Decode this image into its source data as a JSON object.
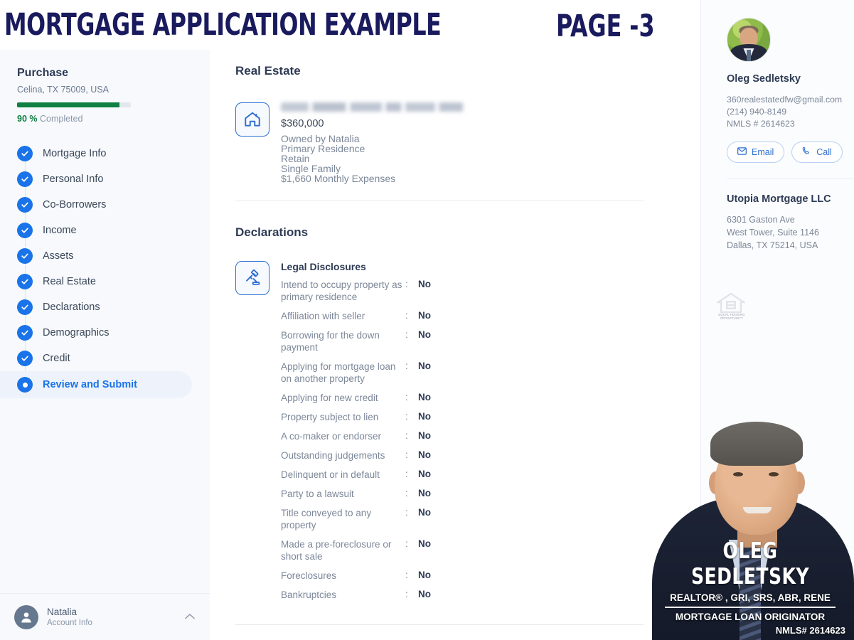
{
  "banner": {
    "title": "MORTGAGE APPLICATION EXAMPLE",
    "page_label": "PAGE -3",
    "color": "#1a1a5e"
  },
  "sidebar": {
    "purchase_label": "Purchase",
    "property_address": "Celina, TX 75009, USA",
    "progress_percent": "90 %",
    "progress_value": 90,
    "progress_suffix": "Completed",
    "progress_color": "#108043",
    "steps": [
      {
        "label": "Mortgage Info",
        "state": "complete"
      },
      {
        "label": "Personal Info",
        "state": "complete"
      },
      {
        "label": "Co-Borrowers",
        "state": "complete"
      },
      {
        "label": "Income",
        "state": "complete"
      },
      {
        "label": "Assets",
        "state": "complete"
      },
      {
        "label": "Real Estate",
        "state": "complete"
      },
      {
        "label": "Declarations",
        "state": "complete"
      },
      {
        "label": "Demographics",
        "state": "complete"
      },
      {
        "label": "Credit",
        "state": "complete"
      },
      {
        "label": "Review and Submit",
        "state": "active"
      }
    ],
    "footer": {
      "user_name": "Natalia",
      "user_sub": "Account Info",
      "chevron": "chevron-up-icon"
    }
  },
  "main": {
    "real_estate": {
      "heading": "Real Estate",
      "icon": "house-icon",
      "address_redacted": "",
      "value": "$360,000",
      "owned_by": "Owned by Natalia",
      "occupancy": "Primary Residence",
      "disposition": "Retain",
      "property_type": "Single Family",
      "expenses": "$1,660 Monthly Expenses"
    },
    "declarations": {
      "heading": "Declarations",
      "icon": "gavel-icon",
      "group_title": "Legal Disclosures",
      "separator": ":",
      "items": [
        {
          "question": "Intend to occupy property as primary residence",
          "answer": "No"
        },
        {
          "question": "Affiliation with seller",
          "answer": "No"
        },
        {
          "question": "Borrowing for the down payment",
          "answer": "No"
        },
        {
          "question": "Applying for mortgage loan on another property",
          "answer": "No"
        },
        {
          "question": "Applying for new credit",
          "answer": "No"
        },
        {
          "question": "Property subject to lien",
          "answer": "No"
        },
        {
          "question": "A co-maker or endorser",
          "answer": "No"
        },
        {
          "question": "Outstanding judgements",
          "answer": "No"
        },
        {
          "question": "Delinquent or in default",
          "answer": "No"
        },
        {
          "question": "Party to a lawsuit",
          "answer": "No"
        },
        {
          "question": "Title conveyed to any property",
          "answer": "No"
        },
        {
          "question": "Made a pre-foreclosure or short sale",
          "answer": "No"
        },
        {
          "question": "Foreclosures",
          "answer": "No"
        },
        {
          "question": "Bankruptcies",
          "answer": "No"
        }
      ]
    }
  },
  "right_panel": {
    "agent": {
      "photo": "agent-avatar",
      "name": "Oleg Sedletsky",
      "email": "360realestatedfw@gmail.com",
      "phone": "(214) 940-8149",
      "nmls": "NMLS # 2614623",
      "email_button": "Email",
      "call_button": "Call",
      "email_icon": "envelope-icon",
      "call_icon": "phone-icon"
    },
    "company": {
      "name": "Utopia Mortgage LLC",
      "address_line1": "6301 Gaston Ave",
      "address_line2": "West Tower, Suite 1146",
      "address_line3": "Dallas, TX 75214, USA"
    },
    "eho_caption": "EQUAL HOUSING OPPORTUNITY",
    "eho_icon": "equal-housing-icon"
  },
  "overlay_badge": {
    "name": "OLEG SEDLETSKY",
    "credentials": "REALTOR® , GRI, SRS, ABR, RENE",
    "role": "MORTGAGE LOAN ORIGINATOR",
    "nmls": "NMLS# 2614623"
  }
}
